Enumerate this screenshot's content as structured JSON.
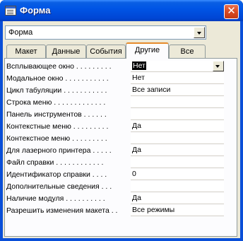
{
  "window": {
    "title": "Форма",
    "close_glyph": "✕",
    "app_icon": "form-icon"
  },
  "object_selector": {
    "value": "Форма"
  },
  "tabs": [
    {
      "label": "Макет",
      "active": false
    },
    {
      "label": "Данные",
      "active": false
    },
    {
      "label": "События",
      "active": false
    },
    {
      "label": "Другие",
      "active": true
    },
    {
      "label": "Все",
      "active": false
    }
  ],
  "properties": [
    {
      "label": "Всплывающее окно . . . . . . . . .",
      "value": "Нет",
      "selected": true
    },
    {
      "label": "Модальное окно . . . . . . . . . . .",
      "value": "Нет"
    },
    {
      "label": "Цикл табуляции . . . . . . . . . . .",
      "value": "Все записи"
    },
    {
      "label": "Строка меню . . . . . . . . . . . . .",
      "value": ""
    },
    {
      "label": "Панель инструментов . . . . . .",
      "value": ""
    },
    {
      "label": "Контекстные меню . . . . . . . . .",
      "value": "Да"
    },
    {
      "label": "Контекстное меню . . . . . . . . .",
      "value": ""
    },
    {
      "label": "Для лазерного принтера . . . . .",
      "value": "Да"
    },
    {
      "label": "Файл справки . . . . . . . . . . . .",
      "value": ""
    },
    {
      "label": "Идентификатор справки . . . .",
      "value": "0"
    },
    {
      "label": "Дополнительные сведения . . .",
      "value": ""
    },
    {
      "label": "Наличие модуля . . . . . . . . . .",
      "value": "Да"
    },
    {
      "label": "Разрешить изменения макета . .",
      "value": "Все режимы"
    }
  ],
  "colors": {
    "titlebar": "#0055e5",
    "dialog_bg": "#ece9d8",
    "active_tab_accent": "#e68b2c",
    "selection_bg": "#000000"
  }
}
